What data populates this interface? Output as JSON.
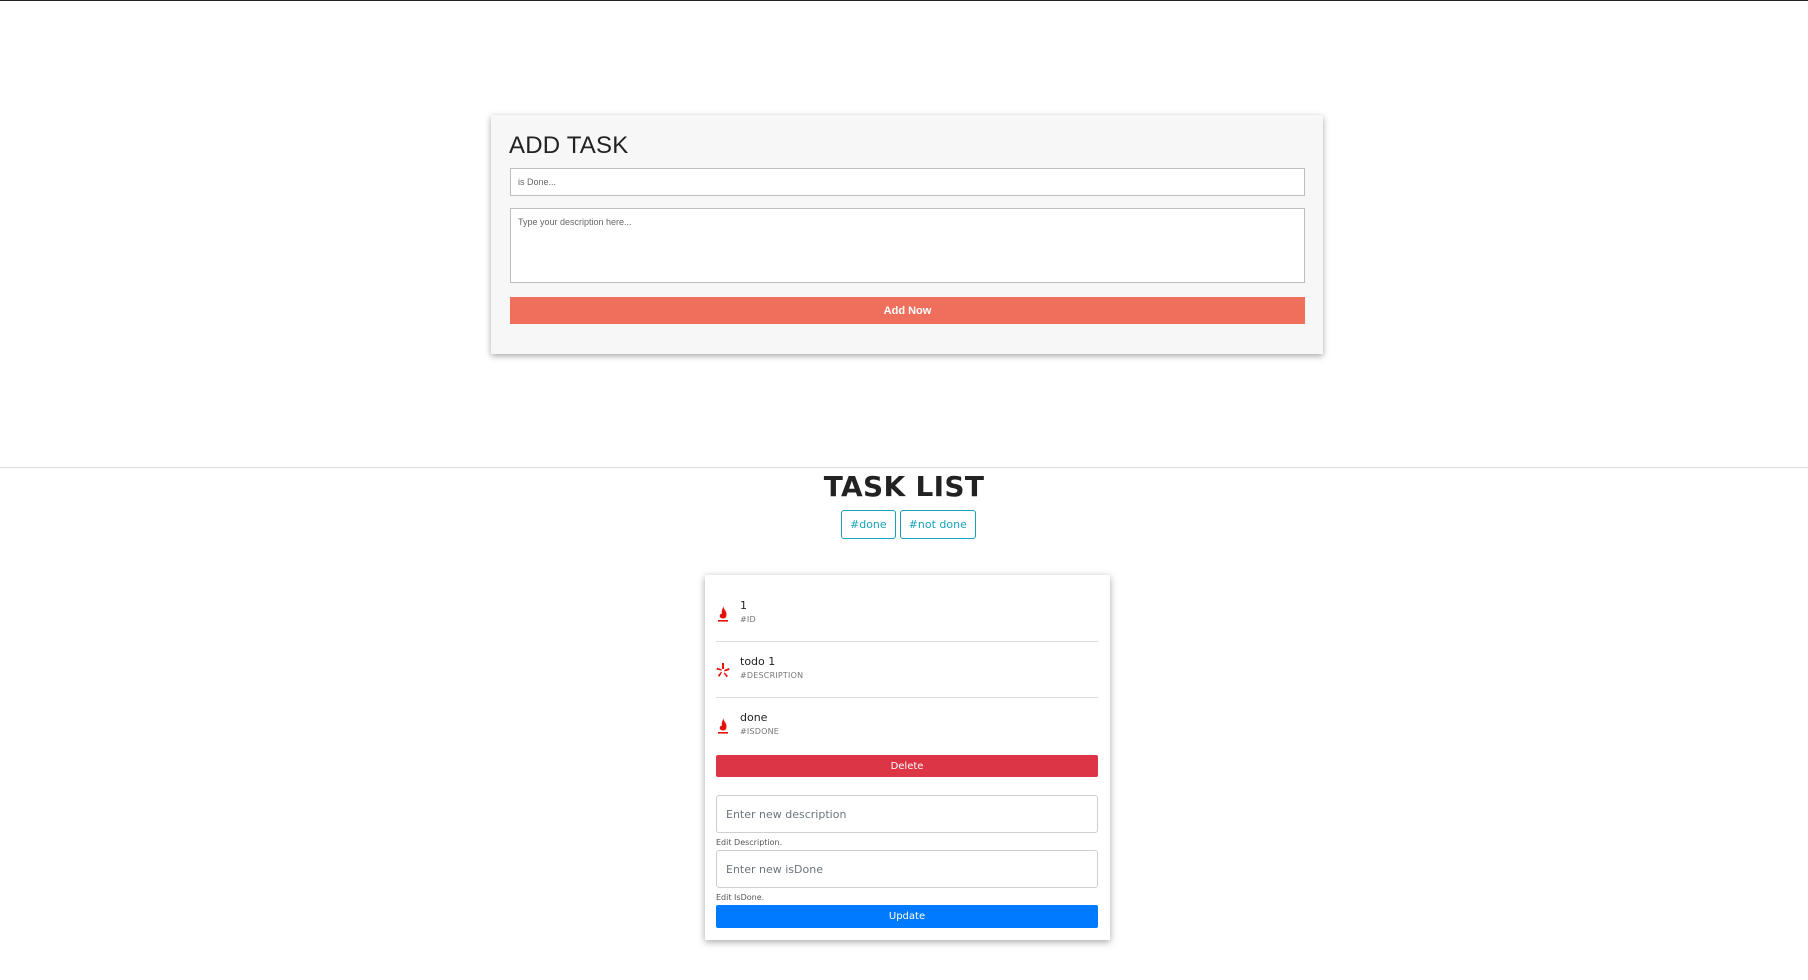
{
  "add_task": {
    "title": "ADD TASK",
    "is_done_placeholder": "is Done...",
    "description_placeholder": "Type your description here...",
    "submit_label": "Add Now"
  },
  "task_list": {
    "title": "TASK LIST",
    "filters": [
      "#done",
      "#not done"
    ]
  },
  "task": {
    "rows": [
      {
        "value": "1",
        "label": "#ID",
        "icon": "fire-icon"
      },
      {
        "value": "todo 1",
        "label": "#DESCRIPTION",
        "icon": "yelp-icon"
      },
      {
        "value": "done",
        "label": "#ISDONE",
        "icon": "fire-icon"
      }
    ],
    "delete_label": "Delete",
    "description_placeholder": "Enter new description",
    "description_helper": "Edit Description.",
    "isdone_placeholder": "Enter new isDone",
    "isdone_helper": "Edit IsDone.",
    "update_label": "Update"
  },
  "colors": {
    "add_button": "#ef6f5c",
    "filter_accent": "#17a2b8",
    "delete": "#dc3545",
    "update": "#007bff",
    "icon_red": "#e3120b"
  }
}
